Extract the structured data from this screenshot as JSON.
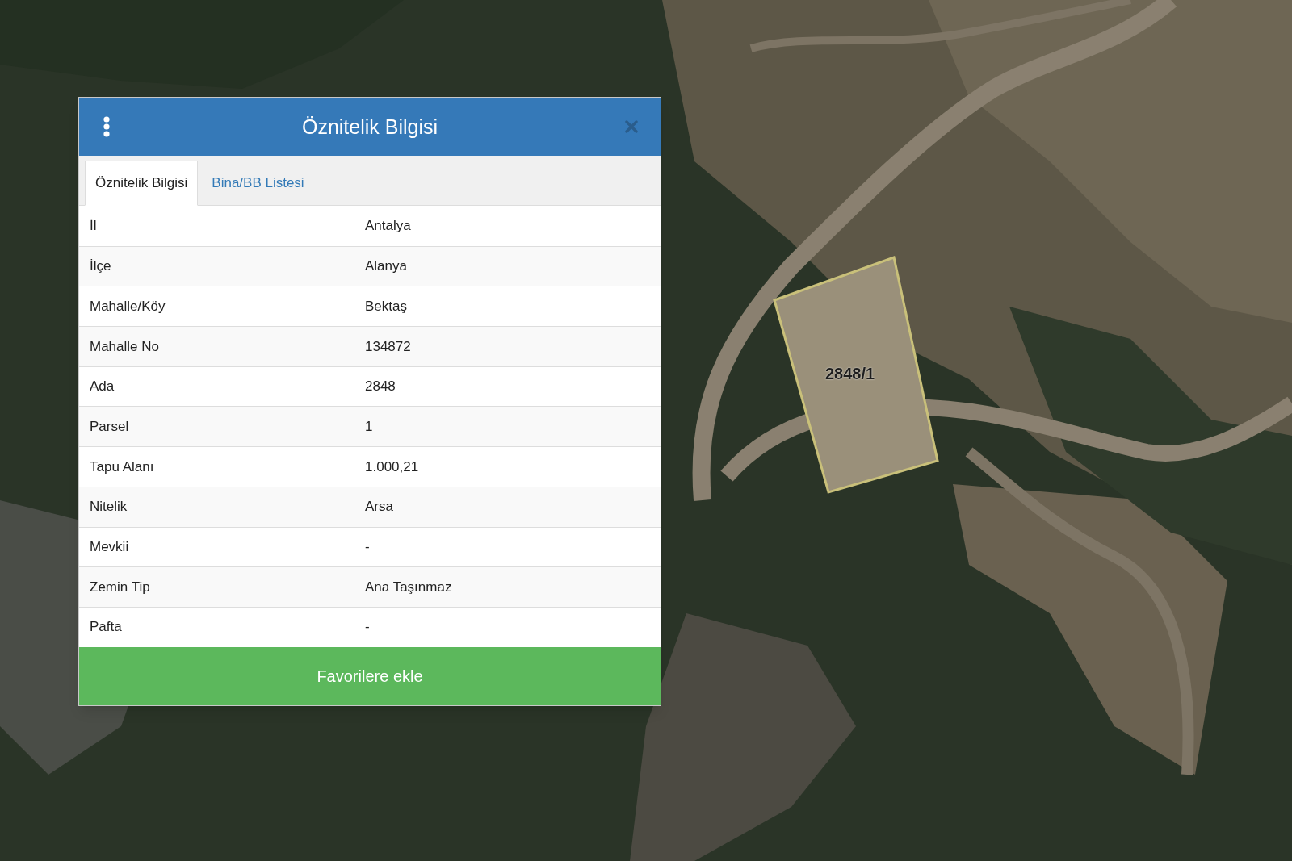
{
  "map": {
    "parcel": {
      "label": "2848/1"
    }
  },
  "panel": {
    "title": "Öznitelik Bilgisi",
    "tabs": [
      {
        "label": "Öznitelik Bilgisi",
        "selected": true
      },
      {
        "label": "Bina/BB Listesi",
        "selected": false
      }
    ],
    "rows": [
      {
        "label": "İl",
        "value": "Antalya"
      },
      {
        "label": "İlçe",
        "value": "Alanya"
      },
      {
        "label": "Mahalle/Köy",
        "value": "Bektaş"
      },
      {
        "label": "Mahalle No",
        "value": "134872"
      },
      {
        "label": "Ada",
        "value": "2848"
      },
      {
        "label": "Parsel",
        "value": "1"
      },
      {
        "label": "Tapu Alanı",
        "value": "1.000,21"
      },
      {
        "label": "Nitelik",
        "value": "Arsa"
      },
      {
        "label": "Mevkii",
        "value": "-"
      },
      {
        "label": "Zemin Tip",
        "value": "Ana Taşınmaz"
      },
      {
        "label": "Pafta",
        "value": "-"
      }
    ],
    "button": "Favorilere ekle"
  }
}
